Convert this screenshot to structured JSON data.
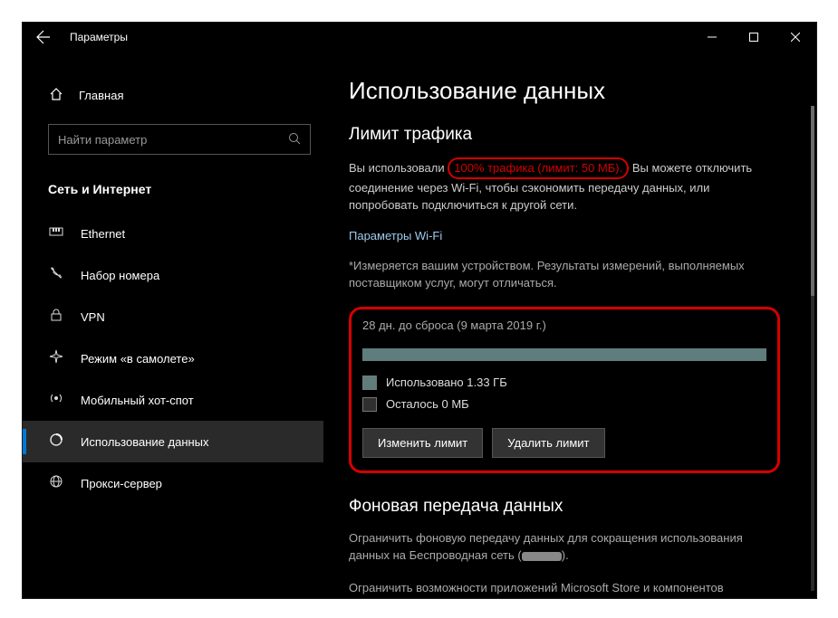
{
  "titlebar": {
    "title": "Параметры"
  },
  "sidebar": {
    "home": "Главная",
    "search_placeholder": "Найти параметр",
    "section": "Сеть и Интернет",
    "items": [
      {
        "label": "Ethernet"
      },
      {
        "label": "Набор номера"
      },
      {
        "label": "VPN"
      },
      {
        "label": "Режим «в самолете»"
      },
      {
        "label": "Мобильный хот-спот"
      },
      {
        "label": "Использование данных"
      },
      {
        "label": "Прокси-сервер"
      }
    ]
  },
  "content": {
    "h1": "Использование данных",
    "limit_heading": "Лимит трафика",
    "usage_para_prefix": "Вы использовали ",
    "usage_highlight": "100% трафика (лимит: 50 МБ).",
    "usage_para_suffix": " Вы можете отключить соединение через Wi-Fi, чтобы сэкономить передачу данных, или попробовать подключиться к другой сети.",
    "wifi_params_link": "Параметры Wi-Fi",
    "disclaimer": "*Измеряется вашим устройством. Результаты измерений, выполняемых поставщиком услуг, могут отличаться.",
    "reset_line": "28 дн. до сброса (9 марта 2019 г.)",
    "legend_used": "Использовано 1.33 ГБ",
    "legend_left": "Осталось 0 МБ",
    "btn_change": "Изменить лимит",
    "btn_remove": "Удалить лимит",
    "bg_heading": "Фоновая передача данных",
    "bg_para1_a": "Ограничить фоновую передачу данных для сокращения использования данных на Беспроводная сеть (",
    "bg_para1_b": ").",
    "bg_para2": "Ограничить возможности приложений Microsoft Store и компонентов Windows в фоновом режиме."
  }
}
